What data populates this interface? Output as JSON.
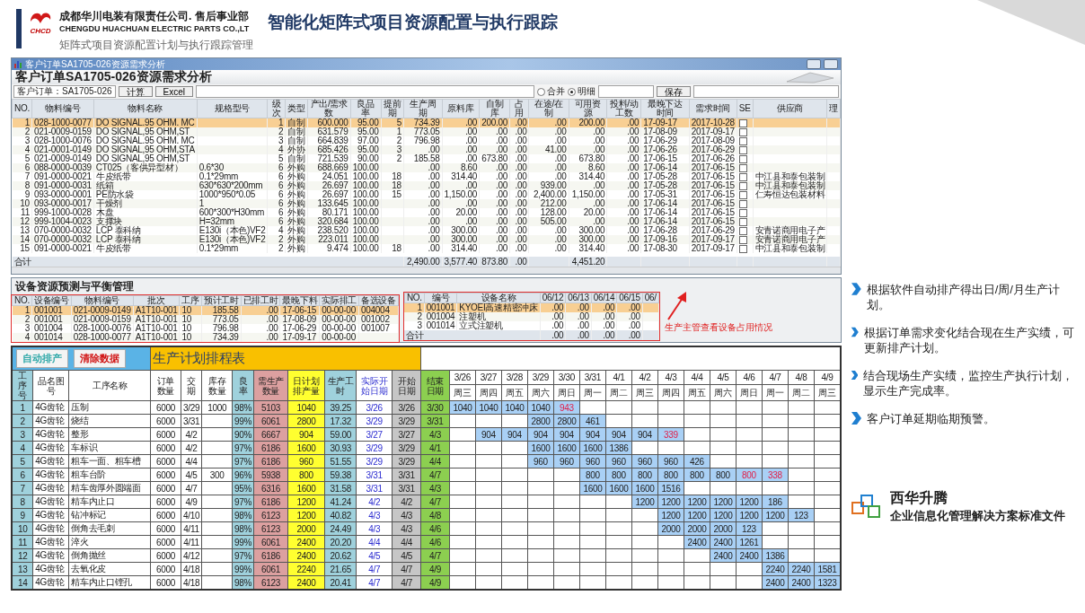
{
  "header": {
    "logo_text": "CHCD",
    "company_cn": "成都华川电装有限责任公司. 售后事业部",
    "company_en": "CHENGDU HUACHUAN ELECTRIC PARTS CO.,LT",
    "title": "智能化矩阵式项目资源配置与执行跟踪",
    "subtitle": "矩阵式项目资源配置计划与执行跟踪管理"
  },
  "resource_window": {
    "title": "客户订单SA1705-026资源需求分析",
    "heading": "客户订单SA1705-026资源需求分析",
    "order_field": "客户订单：SA1705-026",
    "buttons": [
      "计算",
      "Excel"
    ],
    "view_options": [
      {
        "label": "合并",
        "selected": false
      },
      {
        "label": "明细",
        "selected": true
      }
    ],
    "save_button": "保存",
    "columns": [
      {
        "label": "NO.",
        "kind": "num"
      },
      {
        "label": "物料编号",
        "kind": "text"
      },
      {
        "label": "物料名称",
        "kind": "text"
      },
      {
        "label": "规格型号",
        "kind": "text"
      },
      {
        "label": "级次",
        "kind": "num"
      },
      {
        "label": "类型",
        "kind": "text"
      },
      {
        "label": "产出/需求数",
        "kind": "num"
      },
      {
        "label": "良品率",
        "kind": "num"
      },
      {
        "label": "提前期",
        "kind": "num"
      },
      {
        "label": "生产周期",
        "kind": "num"
      },
      {
        "label": "原料库",
        "kind": "num"
      },
      {
        "label": "自制库",
        "kind": "num"
      },
      {
        "label": "占用",
        "kind": "num"
      },
      {
        "label": "在途/在制",
        "kind": "num"
      },
      {
        "label": "可用资源",
        "kind": "num"
      },
      {
        "label": "投料/动工数",
        "kind": "num"
      },
      {
        "label": "最晚下达时间",
        "kind": "text"
      },
      {
        "label": "需求时间",
        "kind": "text"
      },
      {
        "label": "SE",
        "kind": "check"
      },
      {
        "label": "供应商",
        "kind": "text"
      },
      {
        "label": "理",
        "kind": "text"
      }
    ],
    "rows": [
      {
        "selected": true,
        "checked": false,
        "no": "1",
        "code": "028-1000-0077",
        "name": "DO SIGNAL.95 OHM. MC",
        "level": "1",
        "type": "自制",
        "demand": "600.000",
        "yield": "95.00",
        "lead": "5",
        "cycle": "734.39",
        "raw": ".00",
        "made": "200.00",
        "occupied": ".00",
        "transit": ".00",
        "available": "200.00",
        "feed": ".00",
        "latest": "17-09-17",
        "need_date": "2017-10-28"
      },
      {
        "selected": false,
        "checked": false,
        "no": "2",
        "code": "021-0009-0159",
        "name": "DO SIGNAL,95 OHM,ST",
        "level": "2",
        "type": "自制",
        "demand": "631.579",
        "yield": "95.00",
        "lead": "1",
        "cycle": "773.05",
        "raw": ".00",
        "made": ".00",
        "occupied": ".00",
        "transit": ".00",
        "available": ".00",
        "feed": ".00",
        "latest": "17-08-09",
        "need_date": "2017-09-17"
      },
      {
        "selected": false,
        "checked": false,
        "no": "3",
        "code": "028-1000-0076",
        "name": "DO SIGNAL.95 OHM. MC",
        "level": "3",
        "type": "自制",
        "demand": "664.839",
        "yield": "97.00",
        "lead": "2",
        "cycle": "796.98",
        "raw": ".00",
        "made": ".00",
        "occupied": ".00",
        "transit": ".00",
        "available": ".00",
        "feed": ".00",
        "latest": "17-06-29",
        "need_date": "2017-08-09"
      },
      {
        "selected": false,
        "checked": false,
        "no": "4",
        "code": "021-0001-0149",
        "name": "DO SIGNAL,95 OHM,STA",
        "level": "4",
        "type": "外协",
        "demand": "685.426",
        "yield": "95.00",
        "lead": "3",
        "cycle": ".00",
        "raw": ".00",
        "made": ".00",
        "occupied": ".00",
        "transit": "41.00",
        "available": ".00",
        "feed": ".00",
        "latest": "17-06-26",
        "need_date": "2017-06-29"
      },
      {
        "selected": false,
        "checked": false,
        "no": "5",
        "code": "021-0009-0149",
        "name": "DO SIGNAL,95 OHM,ST",
        "level": "5",
        "type": "自制",
        "demand": "721.539",
        "yield": "90.00",
        "lead": "2",
        "cycle": "185.58",
        "raw": ".00",
        "made": "673.80",
        "occupied": ".00",
        "transit": ".00",
        "available": "673.80",
        "feed": ".00",
        "latest": "17-06-15",
        "need_date": "2017-06-26"
      },
      {
        "selected": false,
        "checked": false,
        "no": "6",
        "code": "088-0000-0039",
        "name": "CT025（客供异型材）",
        "spec": "0.6*30",
        "level": "6",
        "type": "外购",
        "demand": "688.669",
        "yield": "100.00",
        "cycle": ".00",
        "raw": "8.60",
        "made": ".00",
        "occupied": ".00",
        "transit": ".00",
        "available": "8.60",
        "feed": ".00",
        "latest": "17-06-14",
        "need_date": "2017-06-15"
      },
      {
        "selected": false,
        "checked": false,
        "no": "7",
        "code": "091-0000-0021",
        "name": "牛皮纸带",
        "spec": "0.1*29mm",
        "level": "6",
        "type": "外购",
        "demand": "24.051",
        "yield": "100.00",
        "lead": "18",
        "cycle": ".00",
        "raw": "314.40",
        "made": ".00",
        "occupied": ".00",
        "transit": ".00",
        "available": "314.40",
        "feed": ".00",
        "latest": "17-05-28",
        "need_date": "2017-06-15",
        "supplier": "中江县和泰包装制"
      },
      {
        "selected": false,
        "checked": false,
        "no": "8",
        "code": "091-0000-0031",
        "name": "纸箱",
        "spec": "630*630*200mm",
        "level": "6",
        "type": "外购",
        "demand": "26.697",
        "yield": "100.00",
        "lead": "18",
        "cycle": ".00",
        "raw": ".00",
        "made": ".00",
        "occupied": ".00",
        "transit": "939.00",
        "available": ".00",
        "feed": ".00",
        "latest": "17-05-28",
        "need_date": "2017-06-15",
        "supplier": "中江县和泰包装制"
      },
      {
        "selected": false,
        "checked": false,
        "no": "9",
        "code": "093-0000-0001",
        "name": "PE防水袋",
        "spec": "1000*950*0.05",
        "level": "6",
        "type": "外购",
        "demand": "26.697",
        "yield": "100.00",
        "lead": "15",
        "cycle": ".00",
        "raw": "1,150.00",
        "made": ".00",
        "occupied": ".00",
        "transit": "2,400.00",
        "available": "1,150.00",
        "feed": ".00",
        "latest": "17-05-31",
        "need_date": "2017-06-15",
        "supplier": "仁寿恒达包装材料"
      },
      {
        "selected": false,
        "checked": false,
        "no": "10",
        "code": "093-0000-0017",
        "name": "干燥剂",
        "spec": "1",
        "level": "6",
        "type": "外购",
        "demand": "133.645",
        "yield": "100.00",
        "cycle": ".00",
        "raw": ".00",
        "made": ".00",
        "occupied": ".00",
        "transit": "212.00",
        "available": ".00",
        "feed": ".00",
        "latest": "17-06-14",
        "need_date": "2017-06-15"
      },
      {
        "selected": false,
        "checked": false,
        "no": "11",
        "code": "999-1000-0028",
        "name": "木盘",
        "spec": "600*300*H30mm",
        "level": "6",
        "type": "外购",
        "demand": "80.171",
        "yield": "100.00",
        "cycle": ".00",
        "raw": "20.00",
        "made": ".00",
        "occupied": ".00",
        "transit": "128.00",
        "available": "20.00",
        "feed": ".00",
        "latest": "17-06-14",
        "need_date": "2017-06-15"
      },
      {
        "selected": false,
        "checked": false,
        "no": "12",
        "code": "999-1004-0023",
        "name": "支撑块",
        "spec": "H=32mm",
        "level": "6",
        "type": "外购",
        "demand": "320.684",
        "yield": "100.00",
        "cycle": ".00",
        "raw": ".00",
        "made": ".00",
        "occupied": ".00",
        "transit": "505.00",
        "available": ".00",
        "feed": ".00",
        "latest": "17-06-14",
        "need_date": "2017-06-15"
      },
      {
        "selected": false,
        "checked": false,
        "no": "13",
        "code": "070-0000-0032",
        "name": "LCP 泰科纳",
        "spec": "E130i（本色)VF2",
        "level": "4",
        "type": "外购",
        "demand": "238.520",
        "yield": "100.00",
        "cycle": ".00",
        "raw": "300.00",
        "made": ".00",
        "occupied": ".00",
        "transit": ".00",
        "available": "300.00",
        "feed": ".00",
        "latest": "17-06-28",
        "need_date": "2017-06-29",
        "supplier": "安青诺商用电子产"
      },
      {
        "selected": false,
        "checked": false,
        "no": "14",
        "code": "070-0000-0032",
        "name": "LCP 泰科纳",
        "spec": "E130i（本色)VF2",
        "level": "2",
        "type": "外购",
        "demand": "223.011",
        "yield": "100.00",
        "cycle": ".00",
        "raw": "300.00",
        "made": ".00",
        "occupied": ".00",
        "transit": ".00",
        "available": "300.00",
        "feed": ".00",
        "latest": "17-09-16",
        "need_date": "2017-09-17",
        "supplier": "安青诺商用电子产"
      },
      {
        "selected": false,
        "checked": false,
        "no": "15",
        "code": "091-0000-0021",
        "name": "牛皮纸带",
        "spec": "0.1*29mm",
        "level": "2",
        "type": "外购",
        "demand": "9.474",
        "yield": "100.00",
        "lead": "18",
        "cycle": ".00",
        "raw": "314.40",
        "made": ".00",
        "occupied": ".00",
        "transit": ".00",
        "available": "314.40",
        "feed": ".00",
        "latest": "17-08-30",
        "need_date": "2017-09-17",
        "supplier": "中江县和泰包装制"
      }
    ],
    "total": {
      "label": "合计",
      "cycle": "2,490.00",
      "raw": "3,577.40",
      "made": "873.80",
      "occupied": ".00",
      "available": "4,451.20"
    }
  },
  "equipment_panel": {
    "heading": "设备资源预测与平衡管理",
    "plan_columns": [
      {
        "label": "NO.",
        "kind": "num"
      },
      {
        "label": "设备编号",
        "kind": "text"
      },
      {
        "label": "物料编号",
        "kind": "text"
      },
      {
        "label": "批次",
        "kind": "text"
      },
      {
        "label": "工序",
        "kind": "text"
      },
      {
        "label": "预计工时",
        "kind": "num"
      },
      {
        "label": "已排工时",
        "kind": "num"
      },
      {
        "label": "最晚下料",
        "kind": "text"
      },
      {
        "label": "实际排工",
        "kind": "text"
      },
      {
        "label": "备选设备",
        "kind": "text"
      }
    ],
    "plan_rows": [
      {
        "selected": true,
        "no": "1",
        "equip": "001001",
        "code": "021-0009-0149",
        "batch": "A1T10-001",
        "step": "10",
        "est": "185.58",
        "done": ".00",
        "latest": "17-06-15",
        "actual": "00-00-00",
        "alt": "004004"
      },
      {
        "selected": false,
        "no": "2",
        "equip": "001001",
        "code": "021-0009-0159",
        "batch": "A1T10-001",
        "step": "10",
        "est": "773.05",
        "done": ".00",
        "latest": "17-08-09",
        "actual": "00-00-00",
        "alt": "001002"
      },
      {
        "selected": false,
        "no": "3",
        "equip": "001004",
        "code": "028-1000-0076",
        "batch": "A1T10-001",
        "step": "10",
        "est": "796.98",
        "done": ".00",
        "latest": "17-06-29",
        "actual": "00-00-00",
        "alt": "001007"
      },
      {
        "selected": false,
        "no": "4",
        "equip": "001014",
        "code": "028-1000-0077",
        "batch": "A1T10-001",
        "step": "10",
        "est": "734.39",
        "done": ".00",
        "latest": "17-09-17",
        "actual": "00-00-00"
      }
    ],
    "usage_columns": [
      {
        "label": "NO.",
        "kind": "num"
      },
      {
        "label": "编号",
        "kind": "text"
      },
      {
        "label": "设备名称",
        "kind": "text"
      },
      {
        "label": "06/12",
        "kind": "num"
      },
      {
        "label": "06/13",
        "kind": "num"
      },
      {
        "label": "06/14",
        "kind": "num"
      },
      {
        "label": "06/15",
        "kind": "num"
      },
      {
        "label": "06/",
        "kind": "num"
      }
    ],
    "usage_rows": [
      {
        "selected": true,
        "no": "1",
        "code": "001001",
        "name": "KYOEI高速精密冲床",
        "d1": ".00",
        "d2": ".00",
        "d3": ".00",
        "d4": ".00"
      },
      {
        "selected": false,
        "no": "2",
        "code": "001004",
        "name": "注塑机",
        "d1": ".00",
        "d2": ".00",
        "d3": ".00",
        "d4": ".00"
      },
      {
        "selected": false,
        "no": "3",
        "code": "001014",
        "name": "立式注塑机",
        "d1": ".00",
        "d2": ".00",
        "d3": ".00",
        "d4": ".00"
      }
    ],
    "usage_total": {
      "label": "合计",
      "d1": ".00",
      "d2": ".00",
      "d3": ".00",
      "d4": ".00"
    },
    "annotation": "生产主管查看设备占用情况"
  },
  "schedule": {
    "buttons": [
      {
        "label": "自动排产",
        "kind": "auto"
      },
      {
        "label": "清除数据",
        "kind": "clear"
      }
    ],
    "title": "生产计划排程表",
    "columns": [
      "工序号",
      "品名图号",
      "工序名称",
      "订单数量",
      "交期",
      "库存数量",
      "良率",
      "需生产数量",
      "日计划排产量",
      "生产工时",
      "实际开始日期",
      "开始日期",
      "结束日期"
    ],
    "dates": [
      {
        "date": "3/26",
        "weekday": "周三"
      },
      {
        "date": "3/27",
        "weekday": "周四"
      },
      {
        "date": "3/28",
        "weekday": "周五"
      },
      {
        "date": "3/29",
        "weekday": "周六"
      },
      {
        "date": "3/30",
        "weekday": "周日"
      },
      {
        "date": "3/31",
        "weekday": "周一"
      },
      {
        "date": "4/1",
        "weekday": "周二"
      },
      {
        "date": "4/2",
        "weekday": "周三"
      },
      {
        "date": "4/3",
        "weekday": "周四"
      },
      {
        "date": "4/4",
        "weekday": "周五"
      },
      {
        "date": "4/5",
        "weekday": "周六"
      },
      {
        "date": "4/6",
        "weekday": "周日"
      },
      {
        "date": "4/7",
        "weekday": "周一"
      },
      {
        "date": "4/8",
        "weekday": "周二"
      },
      {
        "date": "4/9",
        "weekday": "周三"
      }
    ],
    "rows": [
      {
        "no": "1",
        "part": "4G齿轮",
        "op": "压制",
        "order": "6000",
        "due": "3/29",
        "stock": "1000",
        "yield": "98%",
        "need": "5103",
        "daily": "1040",
        "hours": "39.25",
        "actual_start": "3/26",
        "start": "3/26",
        "end": "3/30",
        "plan": [
          {
            "filled": true,
            "qty": "1040",
            "overdue": false
          },
          {
            "filled": true,
            "qty": "1040",
            "overdue": false
          },
          {
            "filled": true,
            "qty": "1040",
            "overdue": false
          },
          {
            "filled": true,
            "qty": "1040",
            "overdue": false
          },
          {
            "filled": true,
            "qty": "943",
            "overdue": true
          },
          {
            "filled": false
          },
          {
            "filled": false
          },
          {
            "filled": false
          },
          {
            "filled": false
          },
          {
            "filled": false
          },
          {
            "filled": false
          },
          {
            "filled": false
          },
          {
            "filled": false
          },
          {
            "filled": false
          },
          {
            "filled": false
          }
        ]
      },
      {
        "no": "2",
        "part": "4G齿轮",
        "op": "烧结",
        "order": "6000",
        "due": "3/31",
        "yield": "99%",
        "need": "6061",
        "daily": "2800",
        "hours": "17.32",
        "actual_start": "3/29",
        "start": "3/29",
        "end": "3/31",
        "plan": [
          {
            "filled": false
          },
          {
            "filled": false
          },
          {
            "filled": false
          },
          {
            "filled": true,
            "qty": "2800",
            "overdue": false
          },
          {
            "filled": true,
            "qty": "2800",
            "overdue": false
          },
          {
            "filled": true,
            "qty": "461",
            "overdue": false
          },
          {
            "filled": false
          },
          {
            "filled": false
          },
          {
            "filled": false
          },
          {
            "filled": false
          },
          {
            "filled": false
          },
          {
            "filled": false
          },
          {
            "filled": false
          },
          {
            "filled": false
          },
          {
            "filled": false
          }
        ]
      },
      {
        "no": "3",
        "part": "4G齿轮",
        "op": "整形",
        "order": "6000",
        "due": "4/2",
        "yield": "90%",
        "need": "6667",
        "daily": "904",
        "hours": "59.00",
        "actual_start": "3/27",
        "start": "3/27",
        "end": "4/3",
        "plan": [
          {
            "filled": false
          },
          {
            "filled": true,
            "qty": "904",
            "overdue": false
          },
          {
            "filled": true,
            "qty": "904",
            "overdue": false
          },
          {
            "filled": true,
            "qty": "904",
            "overdue": false
          },
          {
            "filled": true,
            "qty": "904",
            "overdue": false
          },
          {
            "filled": true,
            "qty": "904",
            "overdue": false
          },
          {
            "filled": true,
            "qty": "904",
            "overdue": false
          },
          {
            "filled": true,
            "qty": "904",
            "overdue": false
          },
          {
            "filled": true,
            "qty": "339",
            "overdue": true
          },
          {
            "filled": false
          },
          {
            "filled": false
          },
          {
            "filled": false
          },
          {
            "filled": false
          },
          {
            "filled": false
          },
          {
            "filled": false
          }
        ]
      },
      {
        "no": "4",
        "part": "4G齿轮",
        "op": "车标识",
        "order": "6000",
        "due": "4/2",
        "yield": "97%",
        "need": "6186",
        "daily": "1600",
        "hours": "30.93",
        "actual_start": "3/29",
        "start": "3/29",
        "end": "4/1",
        "plan": [
          {
            "filled": false
          },
          {
            "filled": false
          },
          {
            "filled": false
          },
          {
            "filled": true,
            "qty": "1600",
            "overdue": false
          },
          {
            "filled": true,
            "qty": "1600",
            "overdue": false
          },
          {
            "filled": true,
            "qty": "1600",
            "overdue": false
          },
          {
            "filled": true,
            "qty": "1386",
            "overdue": false
          },
          {
            "filled": false
          },
          {
            "filled": false
          },
          {
            "filled": false
          },
          {
            "filled": false
          },
          {
            "filled": false
          },
          {
            "filled": false
          },
          {
            "filled": false
          },
          {
            "filled": false
          }
        ]
      },
      {
        "no": "5",
        "part": "4G齿轮",
        "op": "粗车一面、粗车槽",
        "order": "6000",
        "due": "4/4",
        "yield": "97%",
        "need": "6186",
        "daily": "960",
        "hours": "51.55",
        "actual_start": "3/29",
        "start": "3/29",
        "end": "4/4",
        "plan": [
          {
            "filled": false
          },
          {
            "filled": false
          },
          {
            "filled": false
          },
          {
            "filled": true,
            "qty": "960",
            "overdue": false
          },
          {
            "filled": true,
            "qty": "960",
            "overdue": false
          },
          {
            "filled": true,
            "qty": "960",
            "overdue": false
          },
          {
            "filled": true,
            "qty": "960",
            "overdue": false
          },
          {
            "filled": true,
            "qty": "960",
            "overdue": false
          },
          {
            "filled": true,
            "qty": "960",
            "overdue": false
          },
          {
            "filled": true,
            "qty": "426",
            "overdue": false
          },
          {
            "filled": false
          },
          {
            "filled": false
          },
          {
            "filled": false
          },
          {
            "filled": false
          },
          {
            "filled": false
          }
        ]
      },
      {
        "no": "6",
        "part": "4G齿轮",
        "op": "粗车台阶",
        "order": "6000",
        "due": "4/5",
        "stock": "300",
        "yield": "96%",
        "need": "5938",
        "daily": "800",
        "hours": "59.38",
        "actual_start": "3/31",
        "start": "3/31",
        "end": "4/7",
        "plan": [
          {
            "filled": false
          },
          {
            "filled": false
          },
          {
            "filled": false
          },
          {
            "filled": false
          },
          {
            "filled": false
          },
          {
            "filled": true,
            "qty": "800",
            "overdue": false
          },
          {
            "filled": true,
            "qty": "800",
            "overdue": false
          },
          {
            "filled": true,
            "qty": "800",
            "overdue": false
          },
          {
            "filled": true,
            "qty": "800",
            "overdue": false
          },
          {
            "filled": true,
            "qty": "800",
            "overdue": false
          },
          {
            "filled": true,
            "qty": "800",
            "overdue": false
          },
          {
            "filled": true,
            "qty": "800",
            "overdue": true
          },
          {
            "filled": true,
            "qty": "338",
            "overdue": true
          },
          {
            "filled": false
          },
          {
            "filled": false
          }
        ]
      },
      {
        "no": "7",
        "part": "4G齿轮",
        "op": "精车齿厚外圆端面",
        "order": "6000",
        "due": "4/7",
        "yield": "95%",
        "need": "6316",
        "daily": "1600",
        "hours": "31.58",
        "actual_start": "3/31",
        "start": "3/31",
        "end": "4/3",
        "plan": [
          {
            "filled": false
          },
          {
            "filled": false
          },
          {
            "filled": false
          },
          {
            "filled": false
          },
          {
            "filled": false
          },
          {
            "filled": true,
            "qty": "1600",
            "overdue": false
          },
          {
            "filled": true,
            "qty": "1600",
            "overdue": false
          },
          {
            "filled": true,
            "qty": "1600",
            "overdue": false
          },
          {
            "filled": true,
            "qty": "1516",
            "overdue": false
          },
          {
            "filled": false
          },
          {
            "filled": false
          },
          {
            "filled": false
          },
          {
            "filled": false
          },
          {
            "filled": false
          },
          {
            "filled": false
          }
        ]
      },
      {
        "no": "8",
        "part": "4G齿轮",
        "op": "精车内止口",
        "order": "6000",
        "due": "4/9",
        "yield": "97%",
        "need": "6186",
        "daily": "1200",
        "hours": "41.24",
        "actual_start": "4/2",
        "start": "4/2",
        "end": "4/7",
        "plan": [
          {
            "filled": false
          },
          {
            "filled": false
          },
          {
            "filled": false
          },
          {
            "filled": false
          },
          {
            "filled": false
          },
          {
            "filled": false
          },
          {
            "filled": false
          },
          {
            "filled": true,
            "qty": "1200",
            "overdue": false
          },
          {
            "filled": true,
            "qty": "1200",
            "overdue": false
          },
          {
            "filled": true,
            "qty": "1200",
            "overdue": false
          },
          {
            "filled": true,
            "qty": "1200",
            "overdue": false
          },
          {
            "filled": true,
            "qty": "1200",
            "overdue": false
          },
          {
            "filled": true,
            "qty": "186",
            "overdue": false
          },
          {
            "filled": false
          },
          {
            "filled": false
          }
        ]
      },
      {
        "no": "9",
        "part": "4G齿轮",
        "op": "钻冲标记",
        "order": "6000",
        "due": "4/10",
        "yield": "98%",
        "need": "6123",
        "daily": "1200",
        "hours": "40.82",
        "actual_start": "4/3",
        "start": "4/3",
        "end": "4/8",
        "plan": [
          {
            "filled": false
          },
          {
            "filled": false
          },
          {
            "filled": false
          },
          {
            "filled": false
          },
          {
            "filled": false
          },
          {
            "filled": false
          },
          {
            "filled": false
          },
          {
            "filled": false
          },
          {
            "filled": true,
            "qty": "1200",
            "overdue": false
          },
          {
            "filled": true,
            "qty": "1200",
            "overdue": false
          },
          {
            "filled": true,
            "qty": "1200",
            "overdue": false
          },
          {
            "filled": true,
            "qty": "1200",
            "overdue": false
          },
          {
            "filled": true,
            "qty": "1200",
            "overdue": false
          },
          {
            "filled": true,
            "qty": "123",
            "overdue": false
          },
          {
            "filled": false
          }
        ]
      },
      {
        "no": "10",
        "part": "4G齿轮",
        "op": "倒角去毛刺",
        "order": "6000",
        "due": "4/11",
        "yield": "98%",
        "need": "6123",
        "daily": "2000",
        "hours": "24.49",
        "actual_start": "4/3",
        "start": "4/3",
        "end": "4/6",
        "plan": [
          {
            "filled": false
          },
          {
            "filled": false
          },
          {
            "filled": false
          },
          {
            "filled": false
          },
          {
            "filled": false
          },
          {
            "filled": false
          },
          {
            "filled": false
          },
          {
            "filled": false
          },
          {
            "filled": true,
            "qty": "2000",
            "overdue": false
          },
          {
            "filled": true,
            "qty": "2000",
            "overdue": false
          },
          {
            "filled": true,
            "qty": "2000",
            "overdue": false
          },
          {
            "filled": true,
            "qty": "123",
            "overdue": false
          },
          {
            "filled": false
          },
          {
            "filled": false
          },
          {
            "filled": false
          }
        ]
      },
      {
        "no": "11",
        "part": "4G齿轮",
        "op": "淬火",
        "order": "6000",
        "due": "4/11",
        "yield": "99%",
        "need": "6061",
        "daily": "2400",
        "hours": "20.20",
        "actual_start": "4/4",
        "start": "4/4",
        "end": "4/6",
        "plan": [
          {
            "filled": false
          },
          {
            "filled": false
          },
          {
            "filled": false
          },
          {
            "filled": false
          },
          {
            "filled": false
          },
          {
            "filled": false
          },
          {
            "filled": false
          },
          {
            "filled": false
          },
          {
            "filled": false
          },
          {
            "filled": true,
            "qty": "2400",
            "overdue": false
          },
          {
            "filled": true,
            "qty": "2400",
            "overdue": false
          },
          {
            "filled": true,
            "qty": "1261",
            "overdue": false
          },
          {
            "filled": false
          },
          {
            "filled": false
          },
          {
            "filled": false
          }
        ]
      },
      {
        "no": "12",
        "part": "4G齿轮",
        "op": "倒角抛丝",
        "order": "6000",
        "due": "4/12",
        "yield": "97%",
        "need": "6186",
        "daily": "2400",
        "hours": "20.62",
        "actual_start": "4/5",
        "start": "4/5",
        "end": "4/7",
        "plan": [
          {
            "filled": false
          },
          {
            "filled": false
          },
          {
            "filled": false
          },
          {
            "filled": false
          },
          {
            "filled": false
          },
          {
            "filled": false
          },
          {
            "filled": false
          },
          {
            "filled": false
          },
          {
            "filled": false
          },
          {
            "filled": false
          },
          {
            "filled": true,
            "qty": "2400",
            "overdue": false
          },
          {
            "filled": true,
            "qty": "2400",
            "overdue": false
          },
          {
            "filled": true,
            "qty": "1386",
            "overdue": false
          },
          {
            "filled": false
          },
          {
            "filled": false
          }
        ]
      },
      {
        "no": "13",
        "part": "4G齿轮",
        "op": "去氧化皮",
        "order": "6000",
        "due": "4/18",
        "yield": "99%",
        "need": "6061",
        "daily": "2240",
        "hours": "21.65",
        "actual_start": "4/7",
        "start": "4/7",
        "end": "4/9",
        "plan": [
          {
            "filled": false
          },
          {
            "filled": false
          },
          {
            "filled": false
          },
          {
            "filled": false
          },
          {
            "filled": false
          },
          {
            "filled": false
          },
          {
            "filled": false
          },
          {
            "filled": false
          },
          {
            "filled": false
          },
          {
            "filled": false
          },
          {
            "filled": false
          },
          {
            "filled": false
          },
          {
            "filled": true,
            "qty": "2240",
            "overdue": false
          },
          {
            "filled": true,
            "qty": "2240",
            "overdue": false
          },
          {
            "filled": true,
            "qty": "1581",
            "overdue": false
          }
        ]
      },
      {
        "no": "14",
        "part": "4G齿轮",
        "op": "精车内止口镗孔",
        "order": "6000",
        "due": "4/18",
        "yield": "98%",
        "need": "6123",
        "daily": "2400",
        "hours": "20.41",
        "actual_start": "4/7",
        "start": "4/7",
        "end": "4/9",
        "plan": [
          {
            "filled": false
          },
          {
            "filled": false
          },
          {
            "filled": false
          },
          {
            "filled": false
          },
          {
            "filled": false
          },
          {
            "filled": false
          },
          {
            "filled": false
          },
          {
            "filled": false
          },
          {
            "filled": false
          },
          {
            "filled": false
          },
          {
            "filled": false
          },
          {
            "filled": false
          },
          {
            "filled": true,
            "qty": "2400",
            "overdue": false
          },
          {
            "filled": true,
            "qty": "2400",
            "overdue": false
          },
          {
            "filled": true,
            "qty": "1323",
            "overdue": false
          }
        ]
      }
    ]
  },
  "bullets": [
    "根据软件自动排产得出日/周/月生产计划。",
    "根据订单需求变化结合现在生产实绩，可更新排产计划。",
    "结合现场生产实绩，监控生产执行计划，显示生产完成率。",
    "客户订单延期临期预警。"
  ],
  "footer": {
    "brand": "西华升腾",
    "text": "企业信息化管理解决方案标准文件"
  }
}
